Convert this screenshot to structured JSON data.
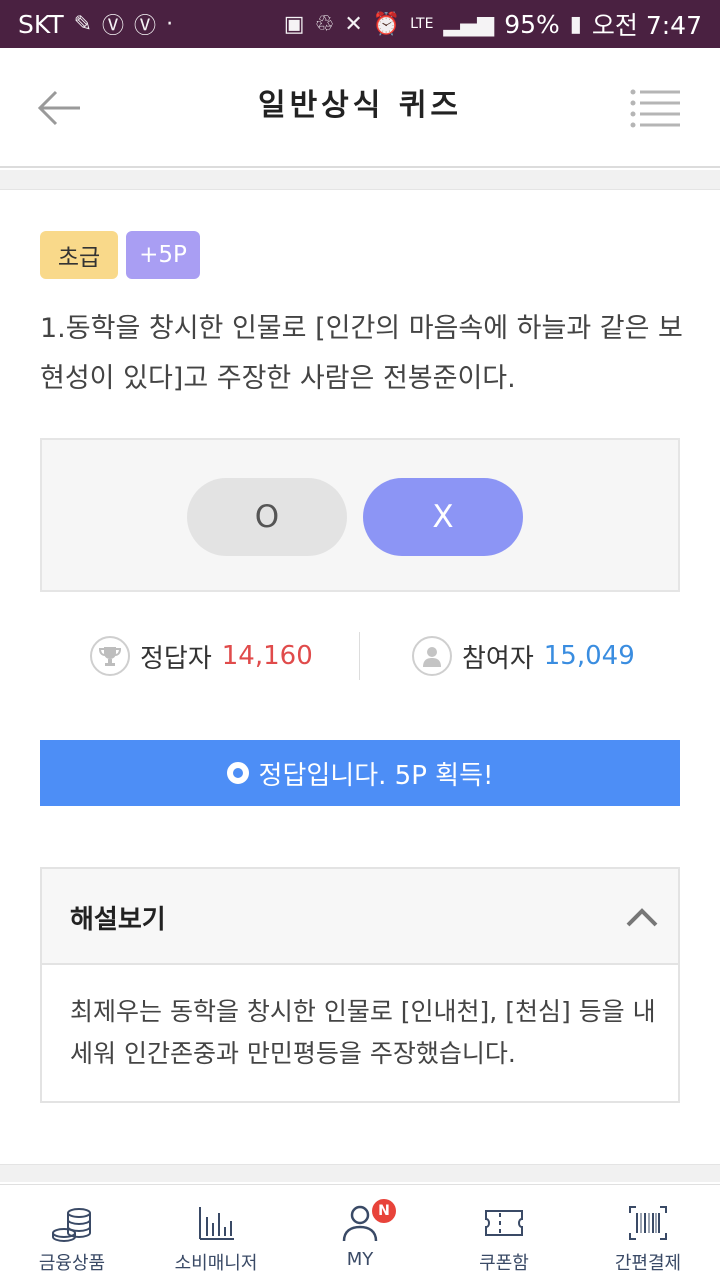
{
  "status_bar": {
    "carrier": "SKT",
    "battery": "95%",
    "time": "오전 7:47",
    "network": "LTE"
  },
  "header": {
    "title": "일반상식 퀴즈"
  },
  "quiz": {
    "level_badge": "초급",
    "point_badge": "+5P",
    "question": "1.동학을 창시한 인물로 [인간의 마음속에 하늘과 같은 보현성이 있다]고 주장한 사람은 전봉준이다.",
    "option_o": "O",
    "option_x": "X",
    "correct_label": "정답자",
    "correct_count": "14,160",
    "participant_label": "참여자",
    "participant_count": "15,049",
    "result_text": "정답입니다. 5P 획득!"
  },
  "explanation": {
    "title": "해설보기",
    "body": "최제우는 동학을 창시한 인물로 [인내천], [천심] 등을 내세워 인간존중과 만민평등을 주장했습니다."
  },
  "tabbar": {
    "items": [
      {
        "label": "금융상품",
        "icon": "coins-icon"
      },
      {
        "label": "소비매니저",
        "icon": "bar-chart-icon"
      },
      {
        "label": "MY",
        "icon": "person-icon",
        "badge": "N"
      },
      {
        "label": "쿠폰함",
        "icon": "ticket-icon"
      },
      {
        "label": "간편결제",
        "icon": "barcode-icon"
      }
    ]
  },
  "colors": {
    "status_bar": "#4a2141",
    "level_badge": "#f9d98a",
    "point_badge": "#a99ef3",
    "selected_answer": "#8c95f5",
    "result_bar": "#4d8ef6",
    "correct_count": "#e04b4b",
    "participant_count": "#3a8de0"
  }
}
